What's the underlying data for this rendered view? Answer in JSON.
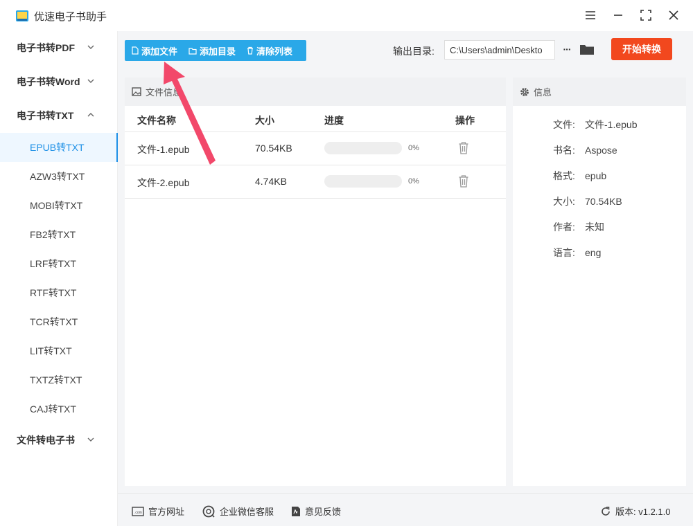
{
  "app": {
    "title": "优速电子书助手"
  },
  "sidebar": {
    "groups": [
      {
        "label": "电子书转PDF"
      },
      {
        "label": "电子书转Word"
      },
      {
        "label": "电子书转TXT"
      },
      {
        "label": "文件转电子书"
      }
    ],
    "items": [
      {
        "label": "EPUB转TXT",
        "active": true
      },
      {
        "label": "AZW3转TXT"
      },
      {
        "label": "MOBI转TXT"
      },
      {
        "label": "FB2转TXT"
      },
      {
        "label": "LRF转TXT"
      },
      {
        "label": "RTF转TXT"
      },
      {
        "label": "TCR转TXT"
      },
      {
        "label": "LIT转TXT"
      },
      {
        "label": "TXTZ转TXT"
      },
      {
        "label": "CAJ转TXT"
      }
    ]
  },
  "toolbar": {
    "add_file": "添加文件",
    "add_dir": "添加目录",
    "clear_list": "清除列表",
    "output_label": "输出目录:",
    "output_value": "C:\\Users\\admin\\Deskto",
    "more_label": "···",
    "start": "开始转换"
  },
  "file_panel": {
    "title": "文件信息",
    "headers": {
      "name": "文件名称",
      "size": "大小",
      "progress": "进度",
      "action": "操作"
    },
    "rows": [
      {
        "name": "文件-1.epub",
        "size": "70.54KB",
        "progress": 0,
        "pct": "0%"
      },
      {
        "name": "文件-2.epub",
        "size": "4.74KB",
        "progress": 0,
        "pct": "0%"
      }
    ]
  },
  "info_panel": {
    "title": "信息",
    "fields": [
      {
        "key": "文件:",
        "value": "文件-1.epub"
      },
      {
        "key": "书名:",
        "value": "Aspose"
      },
      {
        "key": "格式:",
        "value": "epub"
      },
      {
        "key": "大小:",
        "value": "70.54KB"
      },
      {
        "key": "作者:",
        "value": "未知"
      },
      {
        "key": "语言:",
        "value": "eng"
      }
    ]
  },
  "footer": {
    "website": "官方网址",
    "wechat": "企业微信客服",
    "feedback": "意见反馈",
    "version": "版本: v1.2.1.0"
  },
  "colors": {
    "accent": "#2aa8e8",
    "start": "#f2481e",
    "arrow": "#f2486a",
    "active_nav": "#1e90e6"
  },
  "icons": [
    "app-logo-icon",
    "menu-icon",
    "minimize-icon",
    "maximize-icon",
    "close-icon",
    "file-icon",
    "folder-outline-icon",
    "trash-icon",
    "folder-icon",
    "image-icon",
    "gear-icon",
    "website-icon",
    "wechat-icon",
    "feedback-icon",
    "refresh-icon"
  ]
}
